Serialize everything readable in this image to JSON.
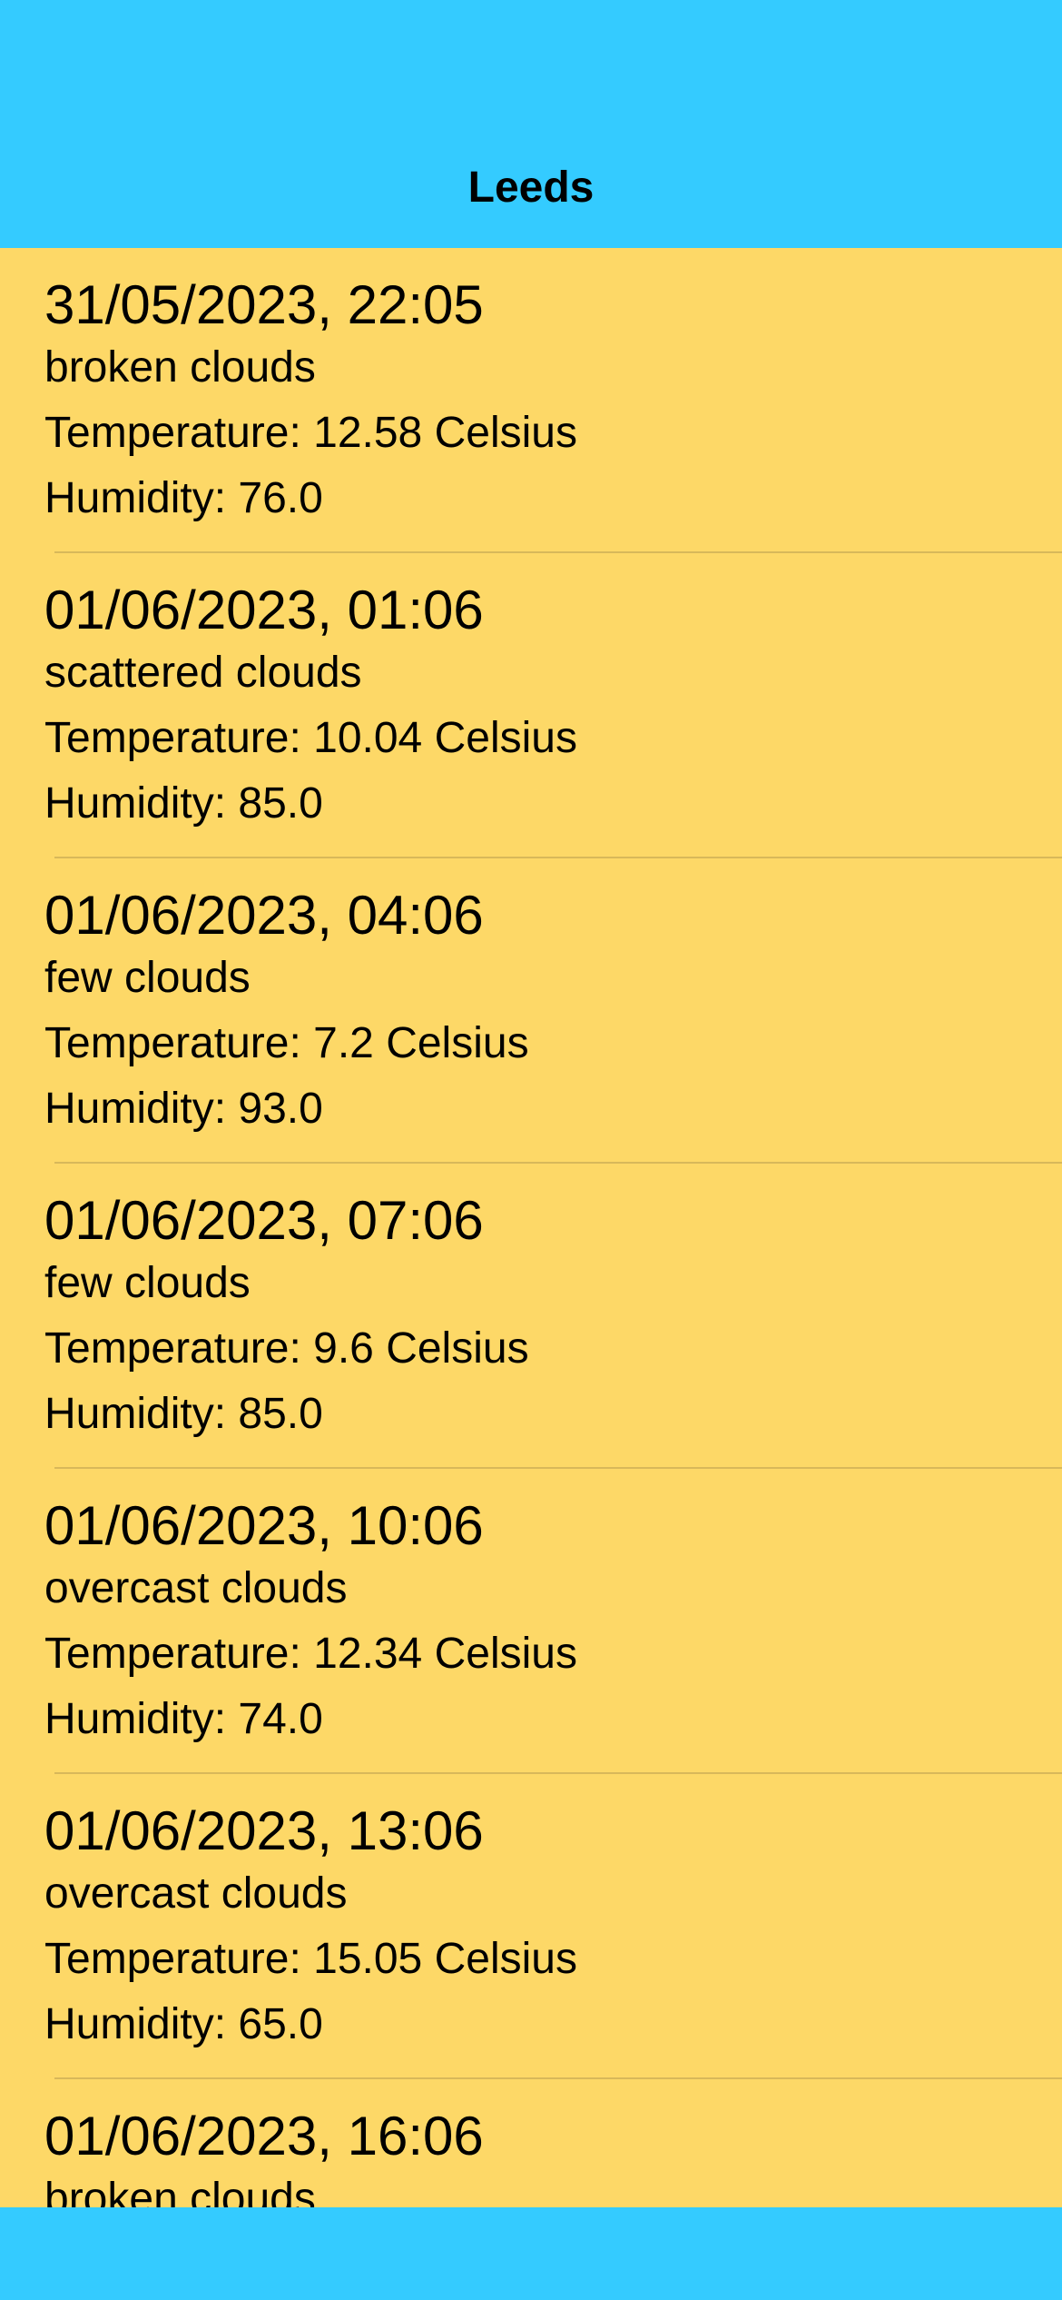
{
  "navbar": {
    "title": "Leeds"
  },
  "colors": {
    "bar_background": "#34CBFF",
    "list_background": "#FDD867"
  },
  "forecast": [
    {
      "datetime": "31/05/2023, 22:05",
      "description": "broken clouds",
      "temperature": "Temperature: 12.58 Celsius",
      "humidity": "Humidity: 76.0"
    },
    {
      "datetime": "01/06/2023, 01:06",
      "description": "scattered clouds",
      "temperature": "Temperature: 10.04 Celsius",
      "humidity": "Humidity: 85.0"
    },
    {
      "datetime": "01/06/2023, 04:06",
      "description": "few clouds",
      "temperature": "Temperature: 7.2 Celsius",
      "humidity": "Humidity: 93.0"
    },
    {
      "datetime": "01/06/2023, 07:06",
      "description": "few clouds",
      "temperature": "Temperature: 9.6 Celsius",
      "humidity": "Humidity: 85.0"
    },
    {
      "datetime": "01/06/2023, 10:06",
      "description": "overcast clouds",
      "temperature": "Temperature: 12.34 Celsius",
      "humidity": "Humidity: 74.0"
    },
    {
      "datetime": "01/06/2023, 13:06",
      "description": "overcast clouds",
      "temperature": "Temperature: 15.05 Celsius",
      "humidity": "Humidity: 65.0"
    },
    {
      "datetime": "01/06/2023, 16:06",
      "description": "broken clouds",
      "temperature": "",
      "humidity": ""
    }
  ]
}
